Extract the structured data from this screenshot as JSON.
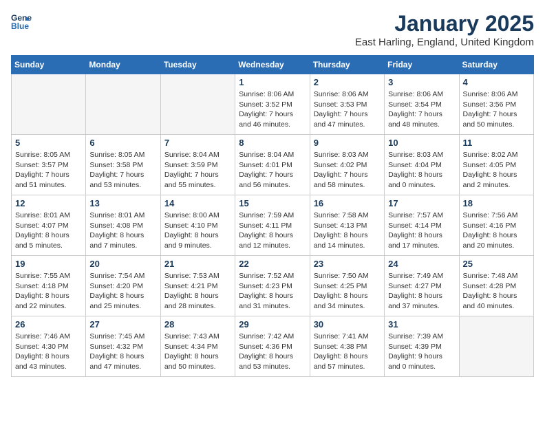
{
  "header": {
    "logo_line1": "General",
    "logo_line2": "Blue",
    "month_title": "January 2025",
    "location": "East Harling, England, United Kingdom"
  },
  "weekdays": [
    "Sunday",
    "Monday",
    "Tuesday",
    "Wednesday",
    "Thursday",
    "Friday",
    "Saturday"
  ],
  "weeks": [
    [
      {
        "day": "",
        "info": ""
      },
      {
        "day": "",
        "info": ""
      },
      {
        "day": "",
        "info": ""
      },
      {
        "day": "1",
        "info": "Sunrise: 8:06 AM\nSunset: 3:52 PM\nDaylight: 7 hours and 46 minutes."
      },
      {
        "day": "2",
        "info": "Sunrise: 8:06 AM\nSunset: 3:53 PM\nDaylight: 7 hours and 47 minutes."
      },
      {
        "day": "3",
        "info": "Sunrise: 8:06 AM\nSunset: 3:54 PM\nDaylight: 7 hours and 48 minutes."
      },
      {
        "day": "4",
        "info": "Sunrise: 8:06 AM\nSunset: 3:56 PM\nDaylight: 7 hours and 50 minutes."
      }
    ],
    [
      {
        "day": "5",
        "info": "Sunrise: 8:05 AM\nSunset: 3:57 PM\nDaylight: 7 hours and 51 minutes."
      },
      {
        "day": "6",
        "info": "Sunrise: 8:05 AM\nSunset: 3:58 PM\nDaylight: 7 hours and 53 minutes."
      },
      {
        "day": "7",
        "info": "Sunrise: 8:04 AM\nSunset: 3:59 PM\nDaylight: 7 hours and 55 minutes."
      },
      {
        "day": "8",
        "info": "Sunrise: 8:04 AM\nSunset: 4:01 PM\nDaylight: 7 hours and 56 minutes."
      },
      {
        "day": "9",
        "info": "Sunrise: 8:03 AM\nSunset: 4:02 PM\nDaylight: 7 hours and 58 minutes."
      },
      {
        "day": "10",
        "info": "Sunrise: 8:03 AM\nSunset: 4:04 PM\nDaylight: 8 hours and 0 minutes."
      },
      {
        "day": "11",
        "info": "Sunrise: 8:02 AM\nSunset: 4:05 PM\nDaylight: 8 hours and 2 minutes."
      }
    ],
    [
      {
        "day": "12",
        "info": "Sunrise: 8:01 AM\nSunset: 4:07 PM\nDaylight: 8 hours and 5 minutes."
      },
      {
        "day": "13",
        "info": "Sunrise: 8:01 AM\nSunset: 4:08 PM\nDaylight: 8 hours and 7 minutes."
      },
      {
        "day": "14",
        "info": "Sunrise: 8:00 AM\nSunset: 4:10 PM\nDaylight: 8 hours and 9 minutes."
      },
      {
        "day": "15",
        "info": "Sunrise: 7:59 AM\nSunset: 4:11 PM\nDaylight: 8 hours and 12 minutes."
      },
      {
        "day": "16",
        "info": "Sunrise: 7:58 AM\nSunset: 4:13 PM\nDaylight: 8 hours and 14 minutes."
      },
      {
        "day": "17",
        "info": "Sunrise: 7:57 AM\nSunset: 4:14 PM\nDaylight: 8 hours and 17 minutes."
      },
      {
        "day": "18",
        "info": "Sunrise: 7:56 AM\nSunset: 4:16 PM\nDaylight: 8 hours and 20 minutes."
      }
    ],
    [
      {
        "day": "19",
        "info": "Sunrise: 7:55 AM\nSunset: 4:18 PM\nDaylight: 8 hours and 22 minutes."
      },
      {
        "day": "20",
        "info": "Sunrise: 7:54 AM\nSunset: 4:20 PM\nDaylight: 8 hours and 25 minutes."
      },
      {
        "day": "21",
        "info": "Sunrise: 7:53 AM\nSunset: 4:21 PM\nDaylight: 8 hours and 28 minutes."
      },
      {
        "day": "22",
        "info": "Sunrise: 7:52 AM\nSunset: 4:23 PM\nDaylight: 8 hours and 31 minutes."
      },
      {
        "day": "23",
        "info": "Sunrise: 7:50 AM\nSunset: 4:25 PM\nDaylight: 8 hours and 34 minutes."
      },
      {
        "day": "24",
        "info": "Sunrise: 7:49 AM\nSunset: 4:27 PM\nDaylight: 8 hours and 37 minutes."
      },
      {
        "day": "25",
        "info": "Sunrise: 7:48 AM\nSunset: 4:28 PM\nDaylight: 8 hours and 40 minutes."
      }
    ],
    [
      {
        "day": "26",
        "info": "Sunrise: 7:46 AM\nSunset: 4:30 PM\nDaylight: 8 hours and 43 minutes."
      },
      {
        "day": "27",
        "info": "Sunrise: 7:45 AM\nSunset: 4:32 PM\nDaylight: 8 hours and 47 minutes."
      },
      {
        "day": "28",
        "info": "Sunrise: 7:43 AM\nSunset: 4:34 PM\nDaylight: 8 hours and 50 minutes."
      },
      {
        "day": "29",
        "info": "Sunrise: 7:42 AM\nSunset: 4:36 PM\nDaylight: 8 hours and 53 minutes."
      },
      {
        "day": "30",
        "info": "Sunrise: 7:41 AM\nSunset: 4:38 PM\nDaylight: 8 hours and 57 minutes."
      },
      {
        "day": "31",
        "info": "Sunrise: 7:39 AM\nSunset: 4:39 PM\nDaylight: 9 hours and 0 minutes."
      },
      {
        "day": "",
        "info": ""
      }
    ]
  ]
}
